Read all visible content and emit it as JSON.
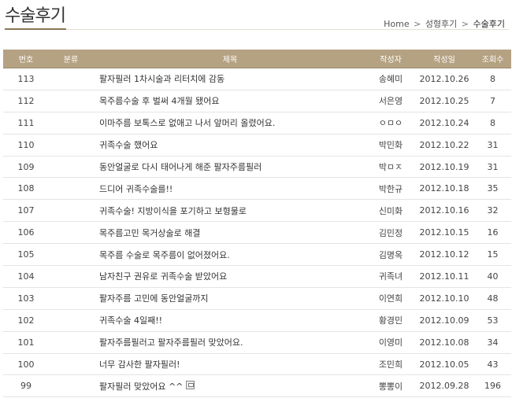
{
  "header": {
    "title": "수술후기",
    "breadcrumb": {
      "home": "Home",
      "category": "성형후기",
      "current": "수술후기",
      "separator": ">"
    }
  },
  "table": {
    "columns": {
      "no": "번호",
      "category": "분류",
      "subject": "제목",
      "author": "작성자",
      "date": "작성일",
      "views": "조회수"
    },
    "rows": [
      {
        "no": "113",
        "category": "",
        "subject": "팔자필러 1차시술과 리터치에 감동",
        "author": "송혜미",
        "date": "2012.10.26",
        "views": "8"
      },
      {
        "no": "112",
        "category": "",
        "subject": "목주름수술 후 벌써 4개월 됐어요",
        "author": "서은영",
        "date": "2012.10.25",
        "views": "7"
      },
      {
        "no": "111",
        "category": "",
        "subject": "이마주름 보톡스로 없애고 나서 앞머리 올렸어요.",
        "author": "ㅇㅁㅇ",
        "date": "2012.10.24",
        "views": "8"
      },
      {
        "no": "110",
        "category": "",
        "subject": "귀족수술 했어요",
        "author": "박민화",
        "date": "2012.10.22",
        "views": "31"
      },
      {
        "no": "109",
        "category": "",
        "subject": "동안얼굴로 다시 태어나게 해준 팔자주름필러",
        "author": "박ㅁㅈ",
        "date": "2012.10.19",
        "views": "31"
      },
      {
        "no": "108",
        "category": "",
        "subject": "드디어 귀족수술를!!",
        "author": "박한규",
        "date": "2012.10.18",
        "views": "35"
      },
      {
        "no": "107",
        "category": "",
        "subject": "귀족수술! 지방이식을 포기하고 보형물로",
        "author": "신미화",
        "date": "2012.10.16",
        "views": "32"
      },
      {
        "no": "106",
        "category": "",
        "subject": "목주름고민 목거상술로 해결",
        "author": "김민정",
        "date": "2012.10.15",
        "views": "16"
      },
      {
        "no": "105",
        "category": "",
        "subject": "목주름 수술로 목주름이 없어졌어요.",
        "author": "김명옥",
        "date": "2012.10.12",
        "views": "15"
      },
      {
        "no": "104",
        "category": "",
        "subject": "남자친구 권유로 귀족수술 받았어요",
        "author": "귀족녀",
        "date": "2012.10.11",
        "views": "40"
      },
      {
        "no": "103",
        "category": "",
        "subject": "팔자주름 고민에 동안얼굴까지",
        "author": "이연희",
        "date": "2012.10.10",
        "views": "48"
      },
      {
        "no": "102",
        "category": "",
        "subject": "귀족수술 4일째!!",
        "author": "황경민",
        "date": "2012.10.09",
        "views": "53"
      },
      {
        "no": "101",
        "category": "",
        "subject": "팔자주름필러고 팔자주름필러 맞았어요.",
        "author": "이영미",
        "date": "2012.10.08",
        "views": "34"
      },
      {
        "no": "100",
        "category": "",
        "subject": "너무 감사한 팔자필러!",
        "author": "조민희",
        "date": "2012.10.05",
        "views": "43"
      },
      {
        "no": "99",
        "category": "",
        "subject": "팔자필러 맞았어요 ^^",
        "author": "뽕뽕이",
        "date": "2012.09.28",
        "views": "196",
        "attachment_icon": "file-attachment-icon"
      }
    ]
  },
  "colors": {
    "header_bg": "#b5a282",
    "title_underline": "#8a7650"
  }
}
